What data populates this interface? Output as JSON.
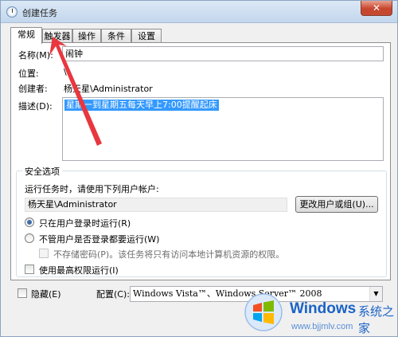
{
  "window": {
    "title": "创建任务",
    "close_glyph": "✕"
  },
  "tabs": [
    {
      "label": "常规",
      "active": true
    },
    {
      "label": "触发器",
      "active": false
    },
    {
      "label": "操作",
      "active": false
    },
    {
      "label": "条件",
      "active": false
    },
    {
      "label": "设置",
      "active": false
    }
  ],
  "general": {
    "name_label": "名称(M):",
    "name_value": "闹钟",
    "location_label": "位置:",
    "location_value": "\\",
    "author_label": "创建者:",
    "author_value": "杨天星\\Administrator",
    "description_label": "描述(D):",
    "description_value": "星期一到星期五每天早上7:00提醒起床"
  },
  "security": {
    "title": "安全选项",
    "run_as_label": "运行任务时，请使用下列用户帐户:",
    "user_account": "杨天星\\Administrator",
    "change_user_button": "更改用户或组(U)...",
    "radio_logged_on": "只在用户登录时运行(R)",
    "radio_any": "不管用户是否登录都要运行(W)",
    "no_store_password": "不存储密码(P)。该任务将只有访问本地计算机资源的权限。",
    "highest_privileges": "使用最高权限运行(I)"
  },
  "footer": {
    "hidden_label": "隐藏(E)",
    "configure_label": "配置(C):",
    "configure_value": "Windows Vista™、Windows Server™ 2008"
  },
  "watermark": {
    "brand": "Windows",
    "cn": "系统之家",
    "url": "www.bjjmlv.com"
  },
  "colors": {
    "selection": "#3399ff",
    "annotation_arrow": "#e8373f",
    "watermark": "#1a63c6"
  }
}
